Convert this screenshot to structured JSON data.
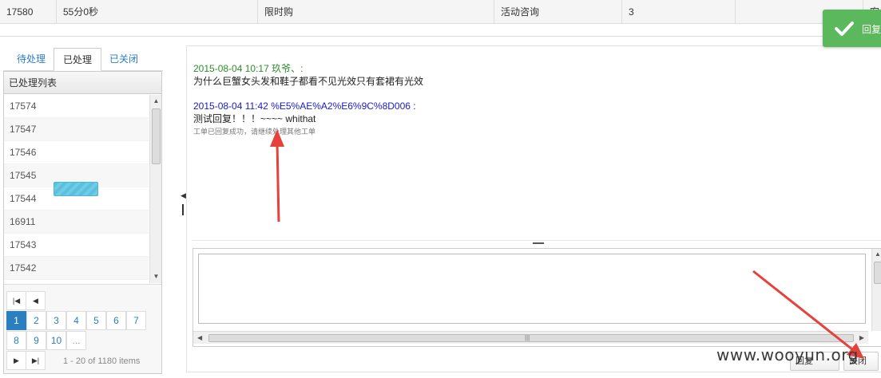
{
  "top_row": {
    "id": "17580",
    "duration": "55分0秒",
    "type": "限时购",
    "category": "活动咨询",
    "count": "3",
    "extra": "",
    "last": "客"
  },
  "tabs": [
    {
      "label": "待处理",
      "active": false
    },
    {
      "label": "已处理",
      "active": true
    },
    {
      "label": "已关闭",
      "active": false
    }
  ],
  "list": {
    "header": "已处理列表",
    "items": [
      "17574",
      "17547",
      "17546",
      "17545",
      "17544",
      "16911",
      "17543",
      "17542"
    ]
  },
  "pager": {
    "pages_row1": [
      "1",
      "2",
      "3",
      "4",
      "5",
      "6",
      "7"
    ],
    "pages_row2": [
      "8",
      "9",
      "10",
      "..."
    ],
    "current": "1",
    "info": "1 - 20 of 1180 items",
    "icons": {
      "first": "first-page-icon",
      "prev": "prev-page-icon",
      "next": "next-page-icon",
      "last": "last-page-icon"
    }
  },
  "messages": [
    {
      "meta": "2015-08-04 10:17 玖爷、:",
      "body": "为什么巨蟹女头发和鞋子都看不见光效只有套裙有光效",
      "color": "#2e8b2e"
    },
    {
      "meta": "2015-08-04 11:42 %E5%AE%A2%E6%9C%8D006 :",
      "body": "测试回复！！！~~~~ whithat",
      "color": "#1a1acc"
    }
  ],
  "status_note": "工单已回复成功，请继续处理其他工单",
  "editor": {
    "value": "",
    "placeholder": ""
  },
  "buttons": {
    "send": "回复",
    "close": "关闭"
  },
  "toast": {
    "text": "回复成功",
    "color": "#5cb85c"
  },
  "watermark": "www.wooyun.org",
  "accent": "#2a7fc1",
  "arrow_color": "#e8403a"
}
